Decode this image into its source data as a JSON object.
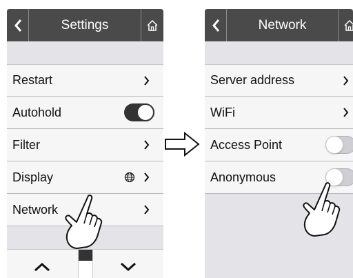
{
  "left_screen": {
    "title": "Settings",
    "back_icon": "chevron-left-icon",
    "home_icon": "home-icon",
    "items": [
      {
        "label": "Restart",
        "control": "chevron"
      },
      {
        "label": "Autohold",
        "control": "toggle",
        "on": true
      },
      {
        "label": "Filter",
        "control": "chevron"
      },
      {
        "label": "Display",
        "control": "chevron",
        "extra_icon": "globe-icon"
      },
      {
        "label": "Network",
        "control": "chevron"
      }
    ],
    "scroll": {
      "up_icon": "caret-up-icon",
      "down_icon": "caret-down-icon"
    }
  },
  "right_screen": {
    "title": "Network",
    "back_icon": "chevron-left-icon",
    "home_icon": "home-icon",
    "items": [
      {
        "label": "Server address",
        "control": "chevron"
      },
      {
        "label": "WiFi",
        "control": "chevron"
      },
      {
        "label": "Access Point",
        "control": "toggle",
        "on": false
      },
      {
        "label": "Anonymous",
        "control": "toggle",
        "on": false
      }
    ]
  },
  "annotations": {
    "flow_icon": "right-arrow-icon",
    "pointer_icon": "pointing-hand-icon"
  },
  "colors": {
    "titlebar": "#4a4a4a",
    "screen_bg": "#e4e3e7",
    "row_bg": "#f6f6f6",
    "toggle_on": "#333333",
    "toggle_off": "#cfcfd3"
  }
}
